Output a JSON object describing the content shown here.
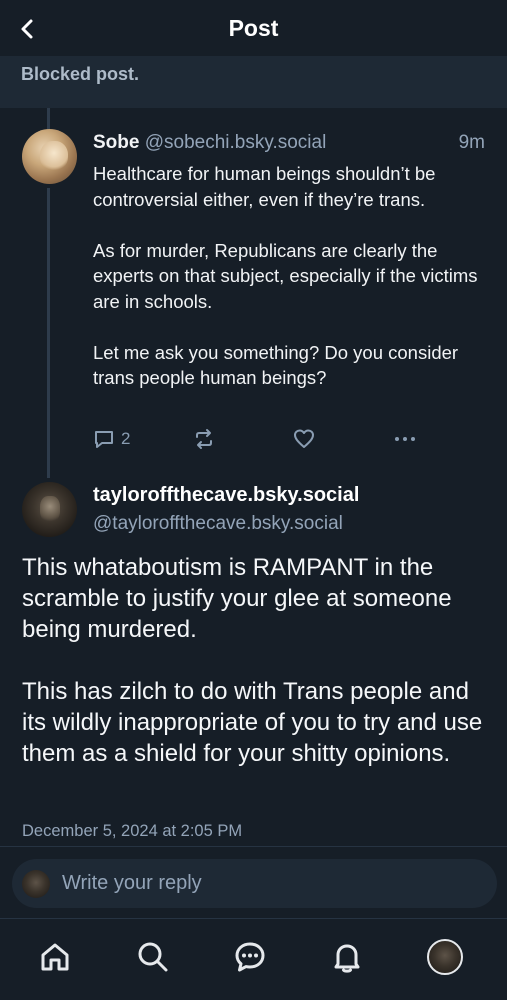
{
  "header": {
    "title": "Post"
  },
  "blocked": {
    "text": "Blocked post."
  },
  "reply_post": {
    "display_name": "Sobe",
    "handle": "@sobechi.bsky.social",
    "time": "9m",
    "body": "Healthcare for human beings shouldn’t be controversial either, even if they’re trans.\n\nAs for murder, Republicans are clearly the experts on that subject, especially if the victims are in schools.\n\nLet me ask you something? Do you consider trans people human beings?",
    "reply_count": "2"
  },
  "main_post": {
    "display_name": "tayloroffthecave.bsky.social",
    "handle": "@tayloroffthecave.bsky.social",
    "body": "This whataboutism is RAMPANT in the scramble to justify your glee at someone being murdered.\n\nThis has zilch to do with Trans people and its wildly inappropriate of you to try and use them as a shield for your shitty opinions.",
    "date": "December 5, 2024 at 2:05 PM"
  },
  "composer": {
    "placeholder": "Write your reply"
  },
  "nav": {
    "items": [
      "home-icon",
      "search-icon",
      "chat-icon",
      "bell-icon",
      "profile-avatar"
    ]
  },
  "colors": {
    "background": "#161e27",
    "surface": "#1e2935",
    "muted_text": "#93a4b8",
    "icon": "#8a9db2"
  }
}
